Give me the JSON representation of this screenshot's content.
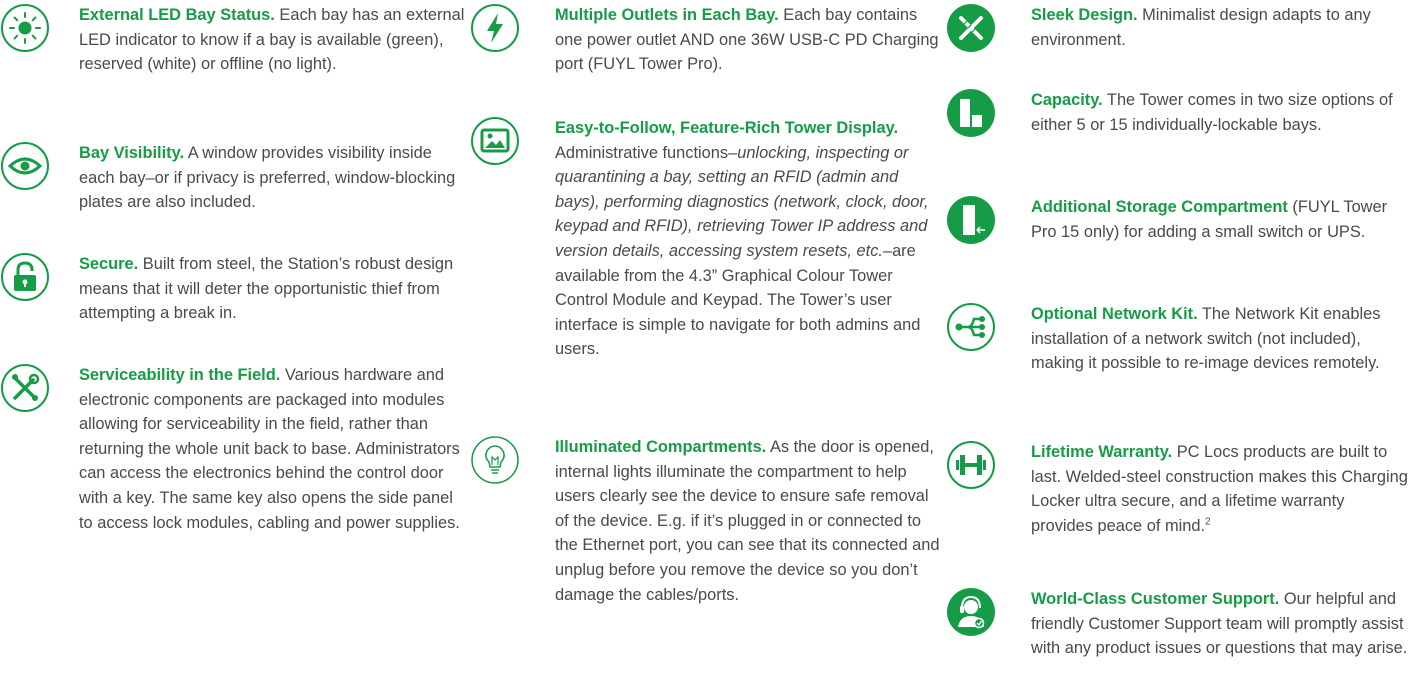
{
  "colors": {
    "accent": "#169c46",
    "text": "#4a4a4a"
  },
  "col1": [
    {
      "icon": "sun-led-icon",
      "title": "External LED Bay Status.",
      "body": " Each bay has an external LED indicator to know if a bay is available (green), reserved (white) or offline (no light)."
    },
    {
      "icon": "eye-icon",
      "title": "Bay Visibility.",
      "body": " A window provides visibility inside each bay–or if privacy is preferred, window-blocking plates are also included."
    },
    {
      "icon": "padlock-icon",
      "title": "Secure.",
      "body": " Built from steel, the Station’s robust design means that it will deter the opportunistic thief from attempting a break in."
    },
    {
      "icon": "wrench-screwdriver-icon",
      "title": "Serviceability in the Field.",
      "body": " Various hardware and electronic components are packaged into modules allowing for serviceability in the field, rather than returning the whole unit back to base. Administrators can access the electronics behind the control door with a key. The same key also opens the side panel to access lock modules, cabling and power supplies."
    }
  ],
  "col2": [
    {
      "icon": "lightning-bolt-icon",
      "title": "Multiple Outlets in Each Bay.",
      "body": " Each bay contains one power outlet AND one 36W USB-C PD Charging port (FUYL Tower Pro)."
    },
    {
      "icon": "picture-display-icon",
      "title": "Easy-to-Follow, Feature-Rich Tower Display.",
      "body_pre": " Administrative functions–",
      "body_em": "unlocking, inspecting or quarantining a bay, setting an RFID (admin and bays), performing diagnostics (network, clock, door, keypad and RFID), retrieving Tower IP address and version details, accessing system resets, etc.",
      "body_post": "–are available from the 4.3” Graphical Colour Tower Control Module and Keypad. The Tower’s user interface is simple to navigate for both admins and users."
    },
    {
      "icon": "lightbulb-icon",
      "title": "Illuminated Compartments.",
      "body": " As the door is opened, internal lights illuminate the compartment to help users clearly see the device to ensure safe removal of the device. E.g. if it’s plugged in or connected to the Ethernet port, you can see that its connected and unplug before you remove the device so you don’t damage the cables/ports."
    }
  ],
  "col3": [
    {
      "icon": "pencil-ruler-icon",
      "title": "Sleek Design.",
      "body": " Minimalist design adapts to any environment."
    },
    {
      "icon": "capacity-blocks-icon",
      "title": "Capacity.",
      "body": " The Tower comes in two size options of either 5 or 15 individually-lockable bays."
    },
    {
      "icon": "storage-compartment-icon",
      "title": "Additional Storage Compartment",
      "body": " (FUYL Tower Pro 15 only) for adding a small switch or UPS."
    },
    {
      "icon": "network-share-icon",
      "title": "Optional Network Kit.",
      "body": " The Network Kit enables installation of a network switch (not included), making it possible to re-image devices remotely."
    },
    {
      "icon": "dumbbell-icon",
      "title": "Lifetime Warranty.",
      "body": " PC Locs products are built to last. Welded-steel construction makes this Charging Locker ultra secure, and a lifetime warranty provides peace of mind.",
      "sup": "2"
    },
    {
      "icon": "support-agent-icon",
      "title": "World-Class Customer Support.",
      "body": " Our helpful and friendly Customer Support team will promptly assist with any product issues or questions that may arise."
    }
  ]
}
